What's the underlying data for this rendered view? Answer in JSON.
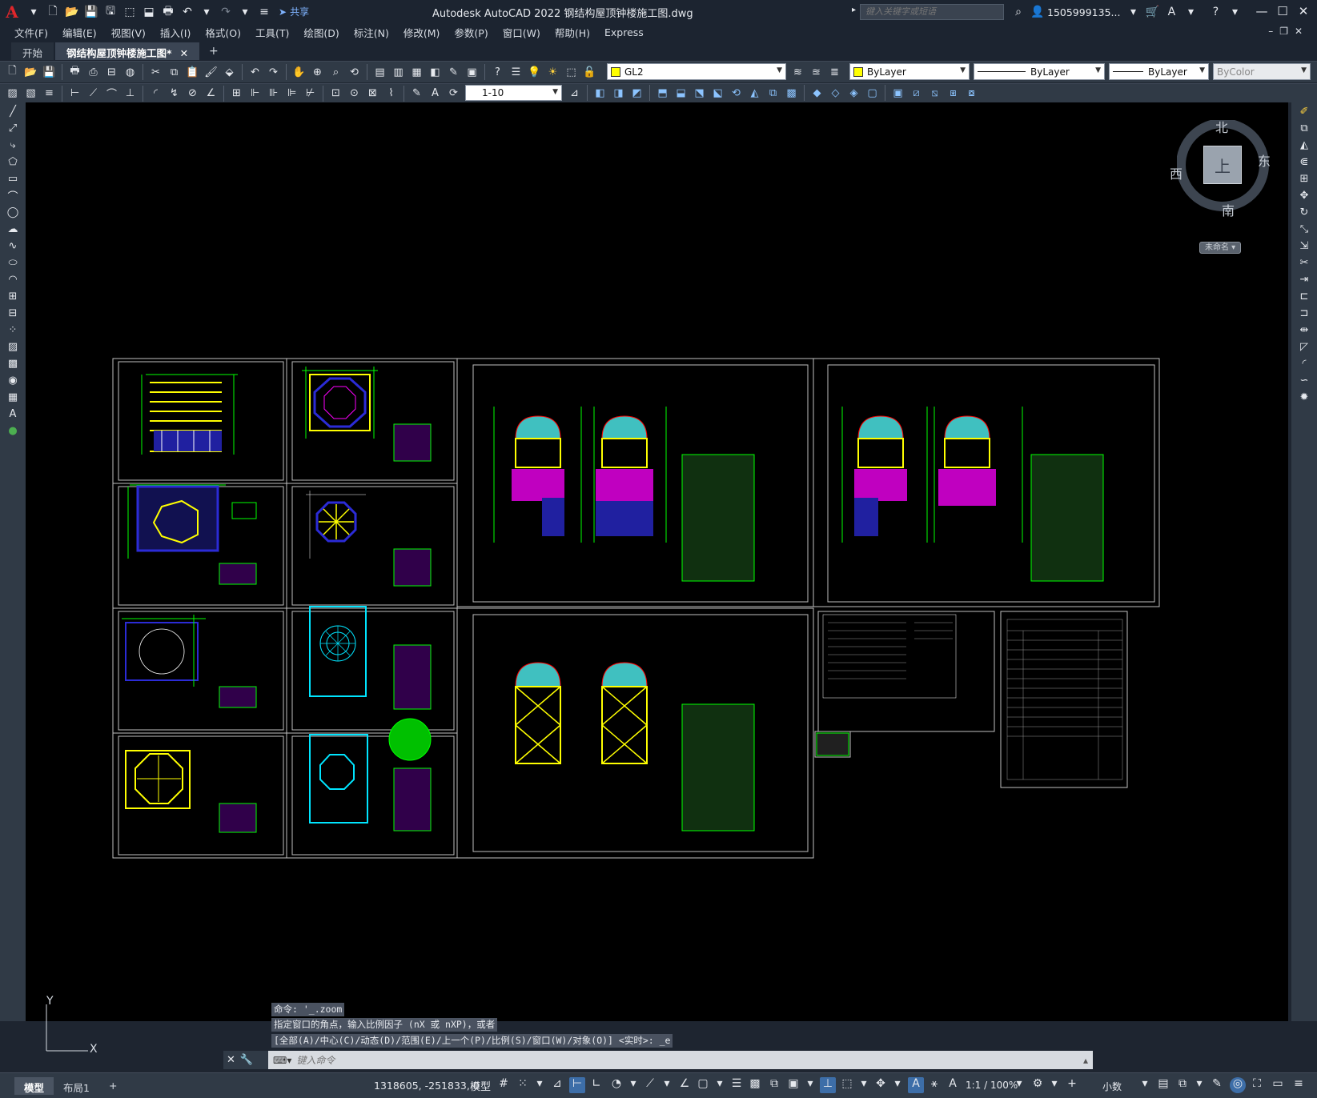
{
  "app": {
    "logo": "A",
    "title": "Autodesk AutoCAD 2022    钢结构屋顶钟楼施工图.dwg",
    "share_label": "共享",
    "search_placeholder": "键入关键字或短语",
    "user": "1505999135...",
    "help": "?"
  },
  "menu": {
    "items": [
      "文件(F)",
      "编辑(E)",
      "视图(V)",
      "插入(I)",
      "格式(O)",
      "工具(T)",
      "绘图(D)",
      "标注(N)",
      "修改(M)",
      "参数(P)",
      "窗口(W)",
      "帮助(H)",
      "Express"
    ]
  },
  "tabs": {
    "start": "开始",
    "active": "钢结构屋顶钟楼施工图*",
    "close": "✕",
    "add": "+"
  },
  "toolbar": {
    "layer": "GL2",
    "color": "ByLayer",
    "linetype": "ByLayer",
    "lineweight": "ByLayer",
    "plotstyle": "ByColor",
    "scale": "1-10"
  },
  "viewcube": {
    "north": "北",
    "south": "南",
    "east": "东",
    "west": "西",
    "top": "上",
    "ucs_name": "未命名 ▾"
  },
  "command": {
    "history": [
      "命令: '_.zoom",
      "指定窗口的角点，输入比例因子 (nX 或 nXP)，或者",
      "[全部(A)/中心(C)/动态(D)/范围(E)/上一个(P)/比例(S)/窗口(W)/对象(O)] <实时>: _e"
    ],
    "placeholder": "键入命令"
  },
  "ucs": {
    "y_label": "Y",
    "x_label": "X"
  },
  "status": {
    "model_tab": "模型",
    "layout_tab": "布局1",
    "add": "+",
    "coordinates": "1318605, -251833, 0",
    "space": "模型",
    "annotation_scale": "1:1 / 100%",
    "units": "小数"
  },
  "colors": {
    "canvas": "#000000",
    "chrome": "#303a46",
    "titlebar": "#1c2430",
    "sheet_border": "#bfbfbf",
    "green": "#00ff00",
    "yellow": "#ffff00",
    "magenta": "#ff00ff",
    "blue": "#2b2bd6",
    "cyan": "#00e5ff"
  }
}
